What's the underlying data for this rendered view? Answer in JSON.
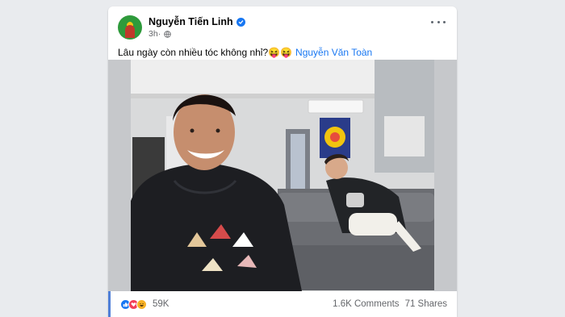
{
  "post": {
    "author": "Nguyễn Tiến Linh",
    "time": "3h",
    "caption_text": "Lâu ngày còn nhiều tóc không nhỉ?😝😝",
    "mention": "Nguyễn Văn Toàn",
    "reaction_count": "59K",
    "comments": "1.6K Comments",
    "shares": "71 Shares"
  },
  "icons": {
    "verified": "verified-badge-icon",
    "audience": "globe-icon",
    "more": "more-horizontal-icon",
    "reactions": [
      "like-icon",
      "love-icon",
      "haha-icon"
    ]
  },
  "colors": {
    "accent": "#1877f2",
    "love": "#f33e58",
    "haha": "#f7b125",
    "secondary_text": "#65676b"
  }
}
